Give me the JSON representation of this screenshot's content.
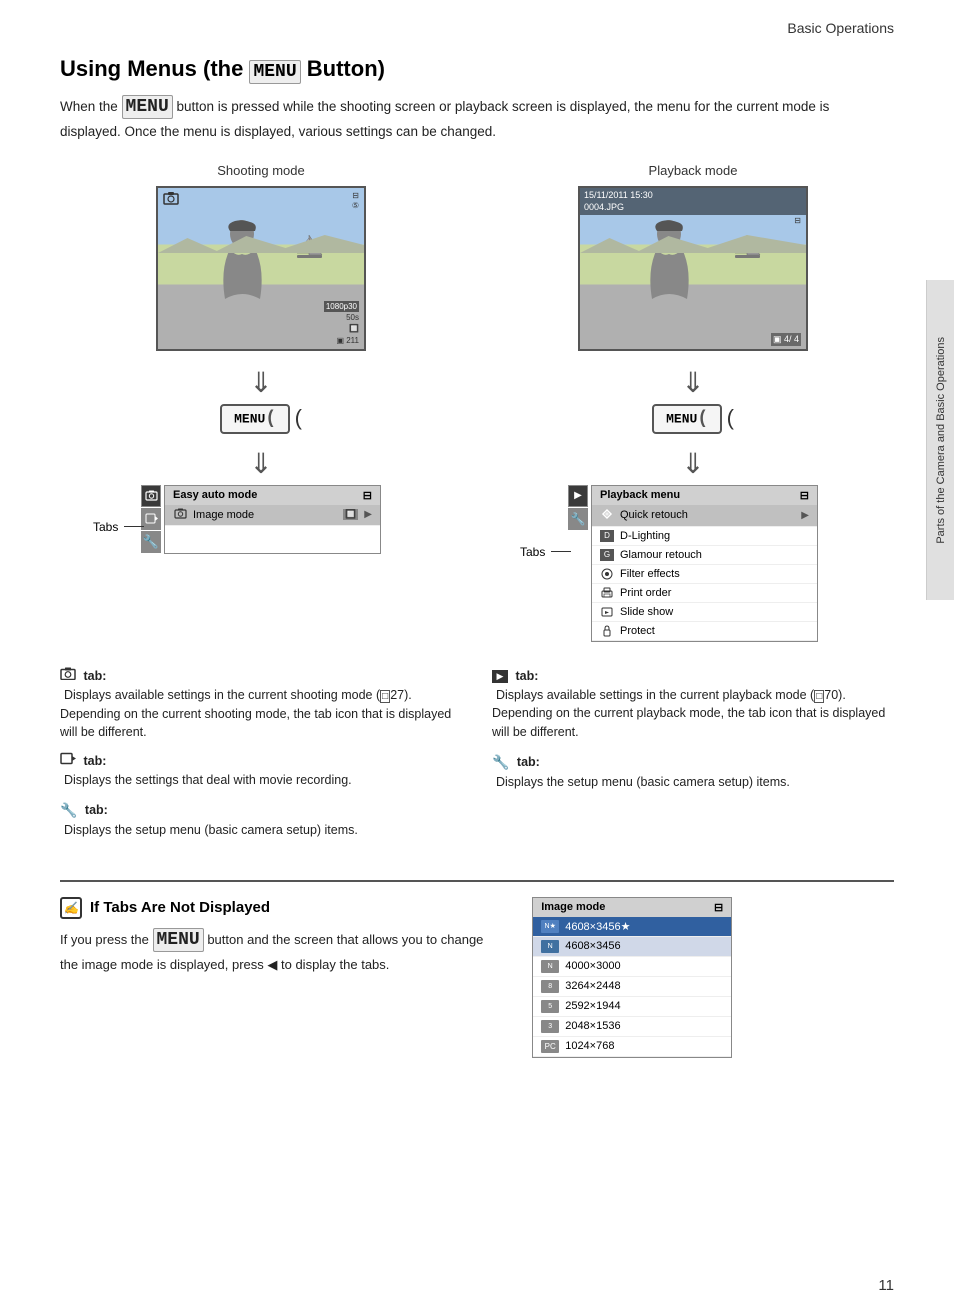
{
  "header": {
    "title": "Basic Operations"
  },
  "section": {
    "title_part1": "Using Menus (the ",
    "title_keyword": "MENU",
    "title_part2": " Button)",
    "intro": "When the MENU button is pressed while the shooting screen or playback screen is displayed, the menu for the current mode is displayed. Once the menu is displayed, various settings can be changed."
  },
  "shooting_mode": {
    "label": "Shooting mode",
    "screen": {
      "top_left_icon": "📷",
      "top_right": "⊟\n⑤",
      "bottom_right": "1080\n50s\n🔲\n▣ 211"
    },
    "menu_btn": "MENU",
    "menu_panel": {
      "header": "Easy auto mode",
      "rows": [
        {
          "icon": "📷",
          "text": "Image mode",
          "badge": "🔲",
          "arrow": "▶",
          "active": true
        }
      ]
    },
    "tabs_label": "Tabs"
  },
  "playback_mode": {
    "label": "Playback mode",
    "screen": {
      "header_line1": "15/11/2011 15:30",
      "header_line2": "0004.JPG",
      "bottom_right": "▣ 4/ 4"
    },
    "menu_btn": "MENU",
    "menu_panel": {
      "header": "Playback menu",
      "rows": [
        {
          "icon": "▶",
          "text": "Quick retouch",
          "arrow": "▶",
          "active": true
        },
        {
          "icon": "D",
          "text": "D-Lighting",
          "arrow": ""
        },
        {
          "icon": "G",
          "text": "Glamour retouch",
          "arrow": ""
        },
        {
          "icon": "F",
          "text": "Filter effects",
          "arrow": ""
        },
        {
          "icon": "P",
          "text": "Print order",
          "arrow": ""
        },
        {
          "icon": "S",
          "text": "Slide show",
          "arrow": ""
        },
        {
          "icon": "O",
          "text": "Protect",
          "arrow": ""
        }
      ]
    },
    "tabs_label": "Tabs"
  },
  "descriptions": {
    "left": [
      {
        "icon": "📷",
        "tab_label": "tab:",
        "content": "Displays available settings in the current shooting mode (□27). Depending on the current shooting mode, the tab icon that is displayed will be different."
      },
      {
        "icon": "🎬",
        "tab_label": "tab:",
        "content": "Displays the settings that deal with movie recording."
      },
      {
        "icon": "🔧",
        "tab_label": "tab:",
        "content": "Displays the setup menu (basic camera setup) items."
      }
    ],
    "right": [
      {
        "icon": "▶",
        "tab_label": "tab:",
        "content": "Displays available settings in the current playback mode (□70). Depending on the current playback mode, the tab icon that is displayed will be different."
      },
      {
        "icon": "🔧",
        "tab_label": "tab:",
        "content": "Displays the setup menu (basic camera setup) items."
      }
    ]
  },
  "note": {
    "icon": "✍",
    "title": "If Tabs Are Not Displayed",
    "text": "If you press the MENU button and the screen that allows you to change the image mode is displayed, press ◀ to display the tabs."
  },
  "image_mode_panel": {
    "header": "Image mode",
    "rows": [
      {
        "icon": "N",
        "text": "4608×3456★",
        "active": true
      },
      {
        "icon": "N",
        "text": "4608×3456",
        "active": false
      },
      {
        "icon": "N",
        "text": "4000×3000",
        "active": false
      },
      {
        "icon": "N",
        "text": "3264×2448",
        "active": false
      },
      {
        "icon": "N",
        "text": "2592×1944",
        "active": false
      },
      {
        "icon": "N",
        "text": "2048×1536",
        "active": false
      },
      {
        "icon": "N",
        "text": "1024×768",
        "active": false
      }
    ]
  },
  "side_tab_text": "Parts of the Camera and Basic Operations",
  "page_number": "11"
}
